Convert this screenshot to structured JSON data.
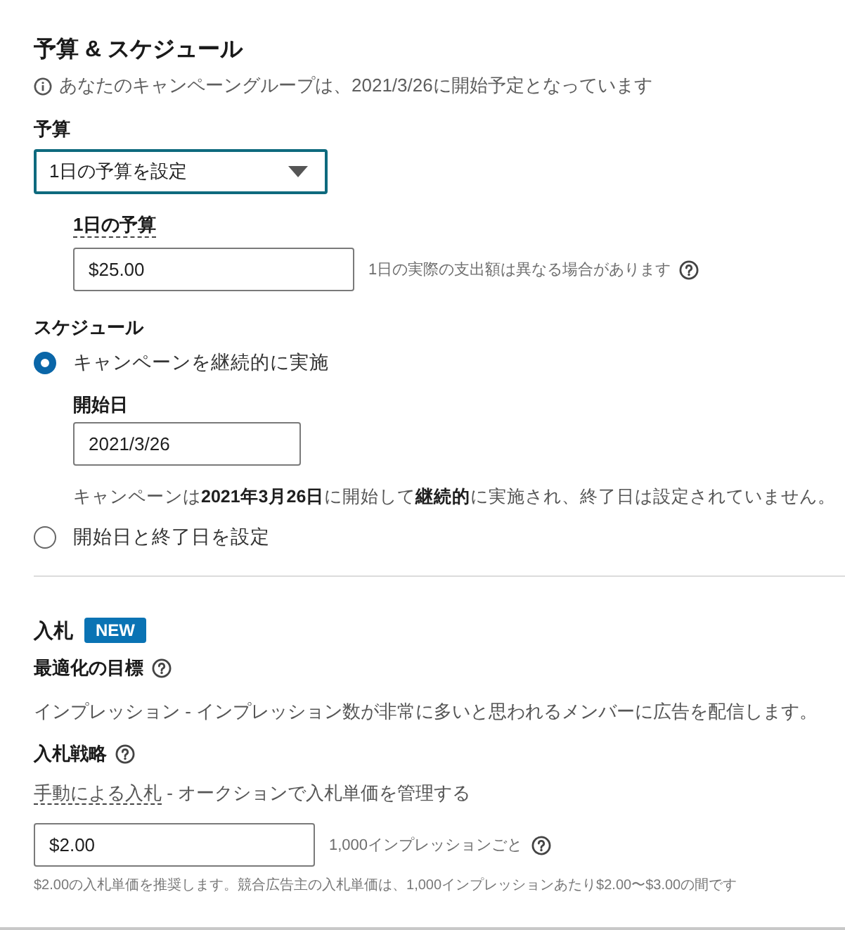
{
  "budget_schedule": {
    "title": "予算 & スケジュール",
    "info": "あなたのキャンペーングループは、2021/3/26に開始予定となっています"
  },
  "budget": {
    "label": "予算",
    "select": {
      "value": "1日の予算を設定",
      "focused": true
    },
    "daily": {
      "label": "1日の予算",
      "value": "$25.00",
      "hint": "1日の実際の支出額は異なる場合があります"
    }
  },
  "schedule": {
    "label": "スケジュール",
    "options": [
      {
        "label": "キャンペーンを継続的に実施",
        "selected": true,
        "start_date": {
          "label": "開始日",
          "value": "2021/3/26"
        },
        "summary": "キャンペーンは**2021年3月26日**に開始して**継続的**に実施され、終了日は設定されていません。"
      },
      {
        "label": "開始日と終了日を設定",
        "selected": false
      }
    ]
  },
  "bidding": {
    "title": "入札",
    "badge": "NEW",
    "goal": {
      "label": "最適化の目標",
      "text": "インプレッション - インプレッション数が非常に多いと思われるメンバーに広告を配信します。"
    },
    "strategy": {
      "label": "入札戦略",
      "method": "手動による入札",
      "method_rest": " - オークションで入札単価を管理する",
      "value": "$2.00",
      "unit": "1,000インプレッションごと",
      "note": "$2.00の入札単価を推奨します。競合広告主の入札単価は、1,000インプレッションあたり$2.00〜$3.00の間です"
    }
  }
}
